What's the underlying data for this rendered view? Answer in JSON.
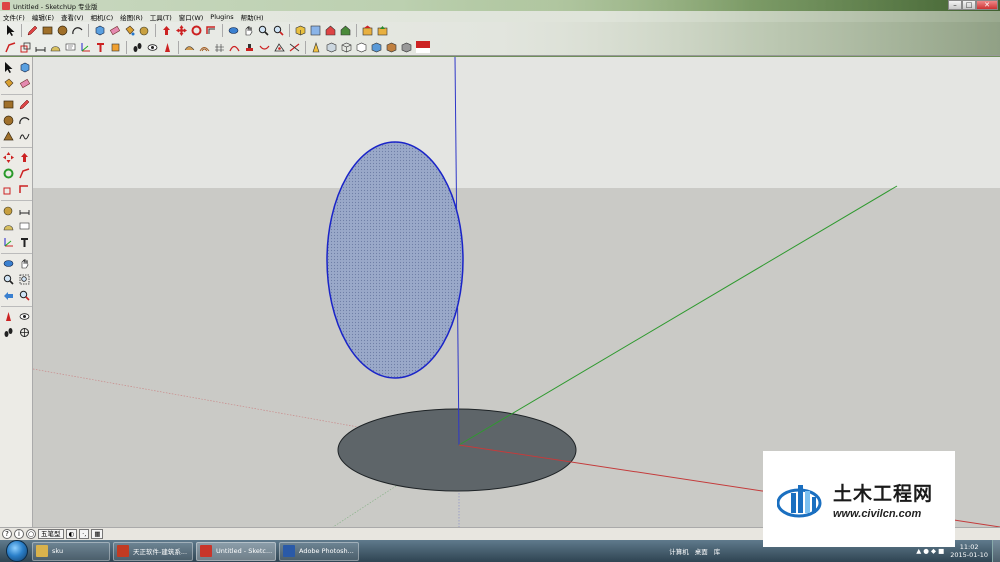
{
  "window": {
    "title": "Untitled - SketchUp 专业版",
    "controls": {
      "minimize": "–",
      "maximize": "□",
      "close": "✕"
    }
  },
  "menubar": {
    "items": [
      "文件(F)",
      "编辑(E)",
      "查看(V)",
      "相机(C)",
      "绘图(R)",
      "工具(T)",
      "窗口(W)",
      "Plugins",
      "帮助(H)"
    ]
  },
  "icons": {
    "toolbar1": [
      "select-arrow-icon",
      "pencil-icon",
      "rectangle-icon",
      "circle-icon",
      "arc-icon",
      "make-component-icon",
      "eraser-icon",
      "paint-bucket-icon",
      "tape-measure-icon",
      "pushpull-icon",
      "move-icon",
      "rotate-icon",
      "offset-icon",
      "orbit-icon",
      "pan-icon",
      "zoom-icon",
      "zoom-extents-icon",
      "iso-view-icon",
      "top-view-icon",
      "front-view-icon",
      "right-view-icon",
      "get-models-icon",
      "share-model-icon"
    ],
    "toolbar2": [
      "followme-icon",
      "scale-icon",
      "dimension-icon",
      "protractor-icon",
      "text-icon",
      "axes-icon",
      "3d-text-icon",
      "section-icon",
      "walk-icon",
      "look-around-icon",
      "position-camera-icon",
      "sandbox-icon",
      "from-contours-icon",
      "from-scratch-icon",
      "smoove-icon",
      "stamp-icon",
      "drape-icon",
      "add-detail-icon",
      "flip-edge-icon",
      "styles-icon",
      "xray-icon",
      "wireframe-icon",
      "hidden-line-icon",
      "shaded-icon",
      "textured-icon",
      "monochrome-icon",
      "su-logo-icon"
    ]
  },
  "statusbar": {
    "style_label": "五笔型",
    "icons": [
      "help-circle-icon",
      "info-circle-icon",
      "geo-icon"
    ]
  },
  "taskbar": {
    "tasks": [
      {
        "label": "sku",
        "color": "#d9b24c"
      },
      {
        "label": "天正软件-建筑系...",
        "color": "#c23b22"
      },
      {
        "label": "Untitled - Sketc...",
        "color": "#c8352a"
      },
      {
        "label": "Adobe Photosh...",
        "color": "#2a5aa8"
      }
    ],
    "tray_computer": "计算机",
    "tray_desktop": "桌面",
    "tray_library": "库",
    "clock_time": "11:02",
    "clock_date": "2015-01-10"
  },
  "watermark": {
    "chinese": "土木工程网",
    "url": "www.civilcn.com"
  },
  "colors": {
    "sky": "#e4e5e2",
    "ground": "#cacac6",
    "vertical_ellipse_fill": "#8fa0c4",
    "vertical_ellipse_edge": "#1a24c8",
    "shadow_fill": "#5e6569",
    "axis_blue": "#2e37c8",
    "axis_green": "#2f9a2f",
    "axis_red": "#c43b3b"
  }
}
